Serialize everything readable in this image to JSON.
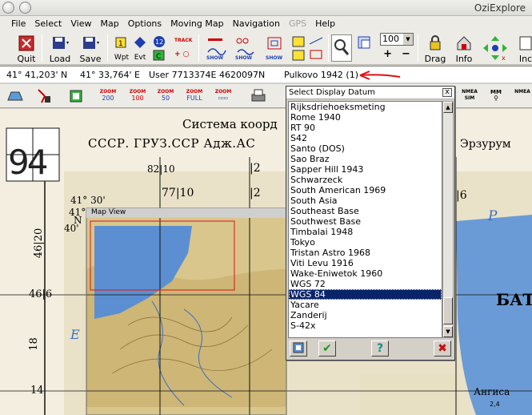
{
  "window": {
    "title": "OziExplore"
  },
  "menu": [
    "File",
    "Select",
    "View",
    "Map",
    "Options",
    "Moving Map",
    "Navigation",
    "GPS",
    "Help"
  ],
  "toolbar": {
    "quit": "Quit",
    "load": "Load",
    "save": "Save",
    "wpt": "Wpt",
    "evt": "Evt",
    "track_label": "TRACK",
    "show_label": "SHOW",
    "zoom_value": "100",
    "drag": "Drag",
    "info": "Info",
    "inc": "Inc"
  },
  "status": {
    "lat": "41° 41,203' N",
    "lon": "41° 33,764' E",
    "grid": "User  7713374E   4620097N",
    "datum": "Pulkovo 1942 (1)"
  },
  "toolbar2": {
    "zoom_buttons": [
      {
        "label": "ZOOM",
        "value": "200"
      },
      {
        "label": "ZOOM",
        "value": "100"
      },
      {
        "label": "ZOOM",
        "value": "50"
      },
      {
        "label": "ZOOM",
        "value": "FULL"
      },
      {
        "label": "ZOOM",
        "value": ""
      }
    ],
    "nmea_sim": "NMEA SIM",
    "mm": "MM",
    "nmea": "NMEA"
  },
  "map": {
    "title_line1": "Система коорд",
    "title_line2": "СССР. ГРУЗ.ССР Адж.АС",
    "city_erzurum": "Эрзурум",
    "city_bat": "БАТ",
    "city_angisa": "Ангиса",
    "sheet_number": "94",
    "coord_41_30": "41° 30'",
    "coord_41": "41°",
    "coord_n": "N",
    "coord_40": "40'",
    "grid_82_10": "82|10",
    "grid_12_top": "|2",
    "grid_77_10": "77|10",
    "grid_12_mid": "|2",
    "grid_16": "|6",
    "side_4620": "46|20",
    "side_4616": "46|6",
    "side_18": "18",
    "side_14": "14",
    "label_p": "P",
    "label_e": "E",
    "map_view_title": "Map View",
    "spot_2_4": "2,4"
  },
  "dialog": {
    "title": "Select Display Datum",
    "close": "x",
    "items": [
      "Rijksdriehoeksmeting",
      "Rome 1940",
      "RT 90",
      "S42",
      "Santo (DOS)",
      "Sao Braz",
      "Sapper Hill 1943",
      "Schwarzeck",
      "South American 1969",
      "South Asia",
      "Southeast Base",
      "Southwest Base",
      "Timbalai 1948",
      "Tokyo",
      "Tristan Astro 1968",
      "Viti Levu 1916",
      "Wake-Eniwetok 1960",
      "WGS 72",
      "WGS 84",
      "Yacare",
      "Zanderij",
      "S-42x"
    ],
    "selected": "WGS 84"
  },
  "colors": {
    "selection": "#0a246a",
    "water": "#5b8fd1",
    "land": "#ddd3b0",
    "arrow": "#e01010"
  }
}
